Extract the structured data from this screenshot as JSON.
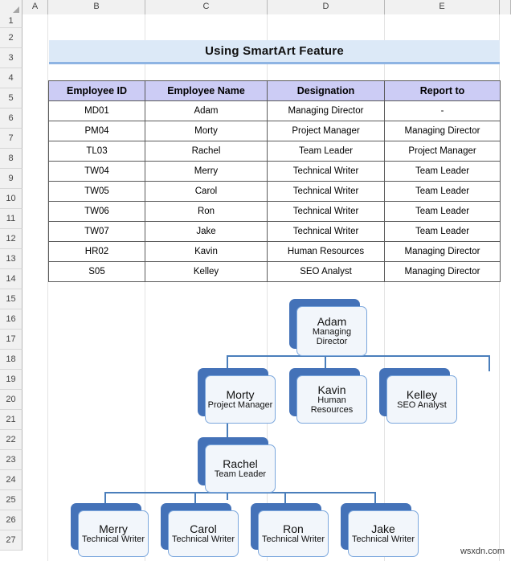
{
  "app": {
    "watermark": "wsxdn.com"
  },
  "grid": {
    "columns": [
      "A",
      "B",
      "C",
      "D",
      "E"
    ],
    "rows": [
      "1",
      "2",
      "3",
      "4",
      "5",
      "6",
      "7",
      "8",
      "9",
      "10",
      "11",
      "12",
      "13",
      "14",
      "15",
      "16",
      "17",
      "18",
      "19",
      "20",
      "21",
      "22",
      "23",
      "24",
      "25",
      "26",
      "27"
    ]
  },
  "title": {
    "text": "Using SmartArt Feature",
    "fill": "#dce9f7",
    "underline": "#8eb4e3"
  },
  "table": {
    "headers": [
      "Employee ID",
      "Employee Name",
      "Designation",
      "Report to"
    ],
    "header_fill": "#ccccf5",
    "rows": [
      [
        "MD01",
        "Adam",
        "Managing Director",
        "-"
      ],
      [
        "PM04",
        "Morty",
        "Project Manager",
        "Managing Director"
      ],
      [
        "TL03",
        "Rachel",
        "Team Leader",
        "Project Manager"
      ],
      [
        "TW04",
        "Merry",
        "Technical Writer",
        "Team Leader"
      ],
      [
        "TW05",
        "Carol",
        "Technical Writer",
        "Team Leader"
      ],
      [
        "TW06",
        "Ron",
        "Technical Writer",
        "Team Leader"
      ],
      [
        "TW07",
        "Jake",
        "Technical Writer",
        "Team Leader"
      ],
      [
        "HR02",
        "Kavin",
        "Human Resources",
        "Managing Director"
      ],
      [
        "S05",
        "Kelley",
        "SEO Analyst",
        "Managing Director"
      ]
    ]
  },
  "smartart": {
    "accent": "#4472b8",
    "node_fill": "#f2f6fb",
    "node_border": "#7ba7dd",
    "connector": "#4a7ebb",
    "nodes": [
      {
        "id": "adam",
        "name": "Adam",
        "title": "Managing Director"
      },
      {
        "id": "morty",
        "name": "Morty",
        "title": "Project Manager"
      },
      {
        "id": "kavin",
        "name": "Kavin",
        "title": "Human Resources"
      },
      {
        "id": "kelley",
        "name": "Kelley",
        "title": "SEO Analyst"
      },
      {
        "id": "rachel",
        "name": "Rachel",
        "title": "Team Leader"
      },
      {
        "id": "merry",
        "name": "Merry",
        "title": "Technical Writer"
      },
      {
        "id": "carol",
        "name": "Carol",
        "title": "Technical Writer"
      },
      {
        "id": "ron",
        "name": "Ron",
        "title": "Technical Writer"
      },
      {
        "id": "jake",
        "name": "Jake",
        "title": "Technical Writer"
      }
    ]
  }
}
